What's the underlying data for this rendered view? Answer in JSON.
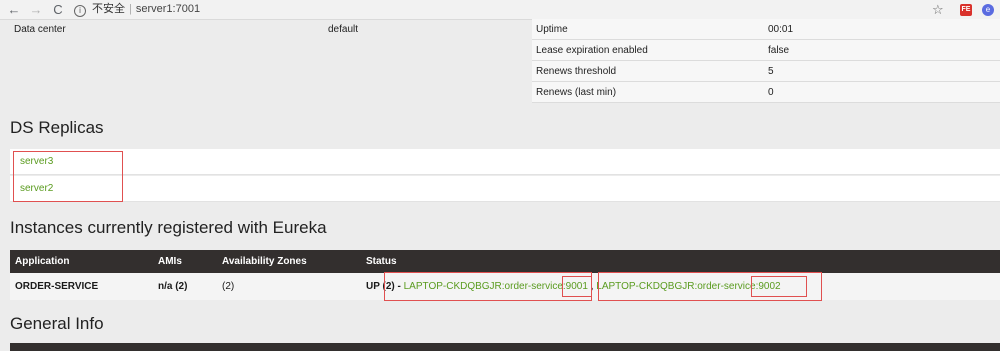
{
  "browser": {
    "back": "←",
    "forward": "→",
    "reload": "C",
    "security_label": "不安全",
    "host": "server1:7001",
    "star": "☆",
    "ext1": "FE",
    "ext2": "e"
  },
  "datacenter": {
    "label": "Data center",
    "value": "default"
  },
  "status_table": [
    {
      "key": "Uptime",
      "value": "00:01"
    },
    {
      "key": "Lease expiration enabled",
      "value": "false"
    },
    {
      "key": "Renews threshold",
      "value": "5"
    },
    {
      "key": "Renews (last min)",
      "value": "0"
    }
  ],
  "ds_replicas": {
    "title": "DS Replicas",
    "items": [
      "server3",
      "server2"
    ]
  },
  "instances": {
    "title": "Instances currently registered with Eureka",
    "headers": [
      "Application",
      "AMIs",
      "Availability Zones",
      "Status"
    ],
    "row": {
      "application": "ORDER-SERVICE",
      "amis": "n/a (2)",
      "zones": "(2)",
      "status_prefix": "UP (2) - ",
      "link1": "LAPTOP-CKDQBGJR:order-service:9001",
      "separator": " , ",
      "link2": "LAPTOP-CKDQBGJR:order-service:9002"
    }
  },
  "general_info": {
    "title": "General Info"
  },
  "colors": {
    "header_dark": "#332f2e",
    "link_green": "#5a9b1f",
    "highlight_red": "#e05050"
  }
}
